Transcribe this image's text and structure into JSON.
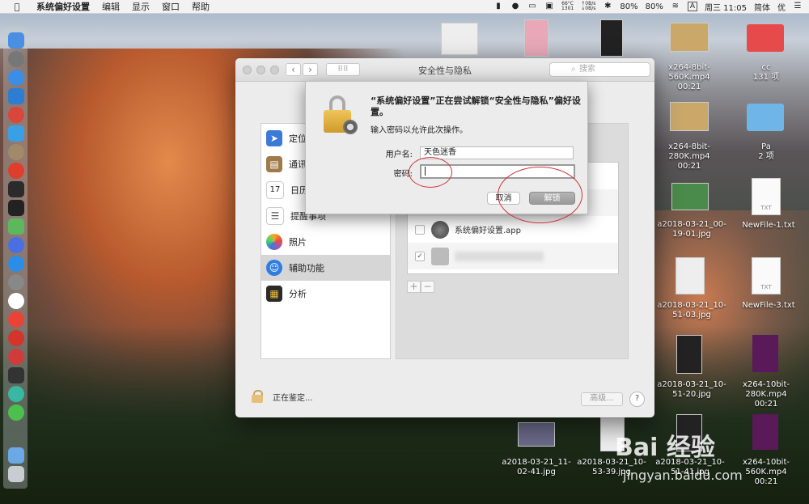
{
  "menubar": {
    "app_name": "系统偏好设置",
    "items": [
      "编辑",
      "显示",
      "窗口",
      "帮助"
    ],
    "temp": "66°C",
    "temp_sub": "1301",
    "net_up": "0B/s",
    "net_down": "0B/s",
    "clock": "周三 11:05",
    "input_method": "简体",
    "user": "优",
    "battery_left": "80%",
    "battery_right": "80%",
    "input_a": "A"
  },
  "window": {
    "title": "安全性与隐私",
    "search_placeholder": "搜索",
    "sidebar": [
      {
        "label": "定位",
        "icon": "location-icon"
      },
      {
        "label": "通讯",
        "icon": "contacts-icon"
      },
      {
        "label": "日历",
        "icon": "calendar-icon",
        "badge": "17"
      },
      {
        "label": "提醒事项",
        "icon": "reminders-icon"
      },
      {
        "label": "照片",
        "icon": "photos-icon"
      },
      {
        "label": "辅助功能",
        "icon": "accessibility-icon",
        "selected": true
      },
      {
        "label": "分析",
        "icon": "analytics-icon"
      }
    ],
    "apps": [
      {
        "name": "系统偏好设置.app",
        "checked": false
      },
      {
        "name": "",
        "checked": true
      }
    ],
    "authenticating": "正在鉴定...",
    "advanced": "高级...",
    "help": "?"
  },
  "sheet": {
    "message": "“系统偏好设置”正在尝试解锁“安全性与隐私”偏好设置。",
    "prompt": "输入密码以允许此次操作。",
    "username_label": "用户名:",
    "username_value": "天色迷香",
    "password_label": "密码:",
    "password_value": "",
    "cancel": "取消",
    "unlock": "解锁"
  },
  "desktop": {
    "files": [
      {
        "name": "x264-8bit-560K.mp4",
        "meta": "00:21"
      },
      {
        "name": "cc",
        "meta": "131 项"
      },
      {
        "name": "x264-8bit-280K.mp4",
        "meta": "00:21"
      },
      {
        "name": "Pa",
        "meta": "2 项"
      },
      {
        "name": "a2018-03-21_00-19-01.jpg",
        "meta": ""
      },
      {
        "name": "NewFile-1.txt",
        "meta": ""
      },
      {
        "name": "a2018-03-21_10-51-03.jpg",
        "meta": ""
      },
      {
        "name": "NewFile-3.txt",
        "meta": ""
      },
      {
        "name": "a2018-03-21_10-51-20.jpg",
        "meta": ""
      },
      {
        "name": "x264-10bit-280K.mp4",
        "meta": "00:21"
      },
      {
        "name": "a2018-03-21_11-02-41.jpg",
        "meta": ""
      },
      {
        "name": "a2018-03-21_10-53-39.jpg",
        "meta": ""
      },
      {
        "name": "a2018-03-21_10-51-41.jpg",
        "meta": ""
      },
      {
        "name": "x264-10bit-560K.mp4",
        "meta": "00:21"
      }
    ],
    "txt_label": "TXT"
  },
  "watermark": {
    "brand": "Bai  经验",
    "url": "jingyan.baidu.com"
  }
}
